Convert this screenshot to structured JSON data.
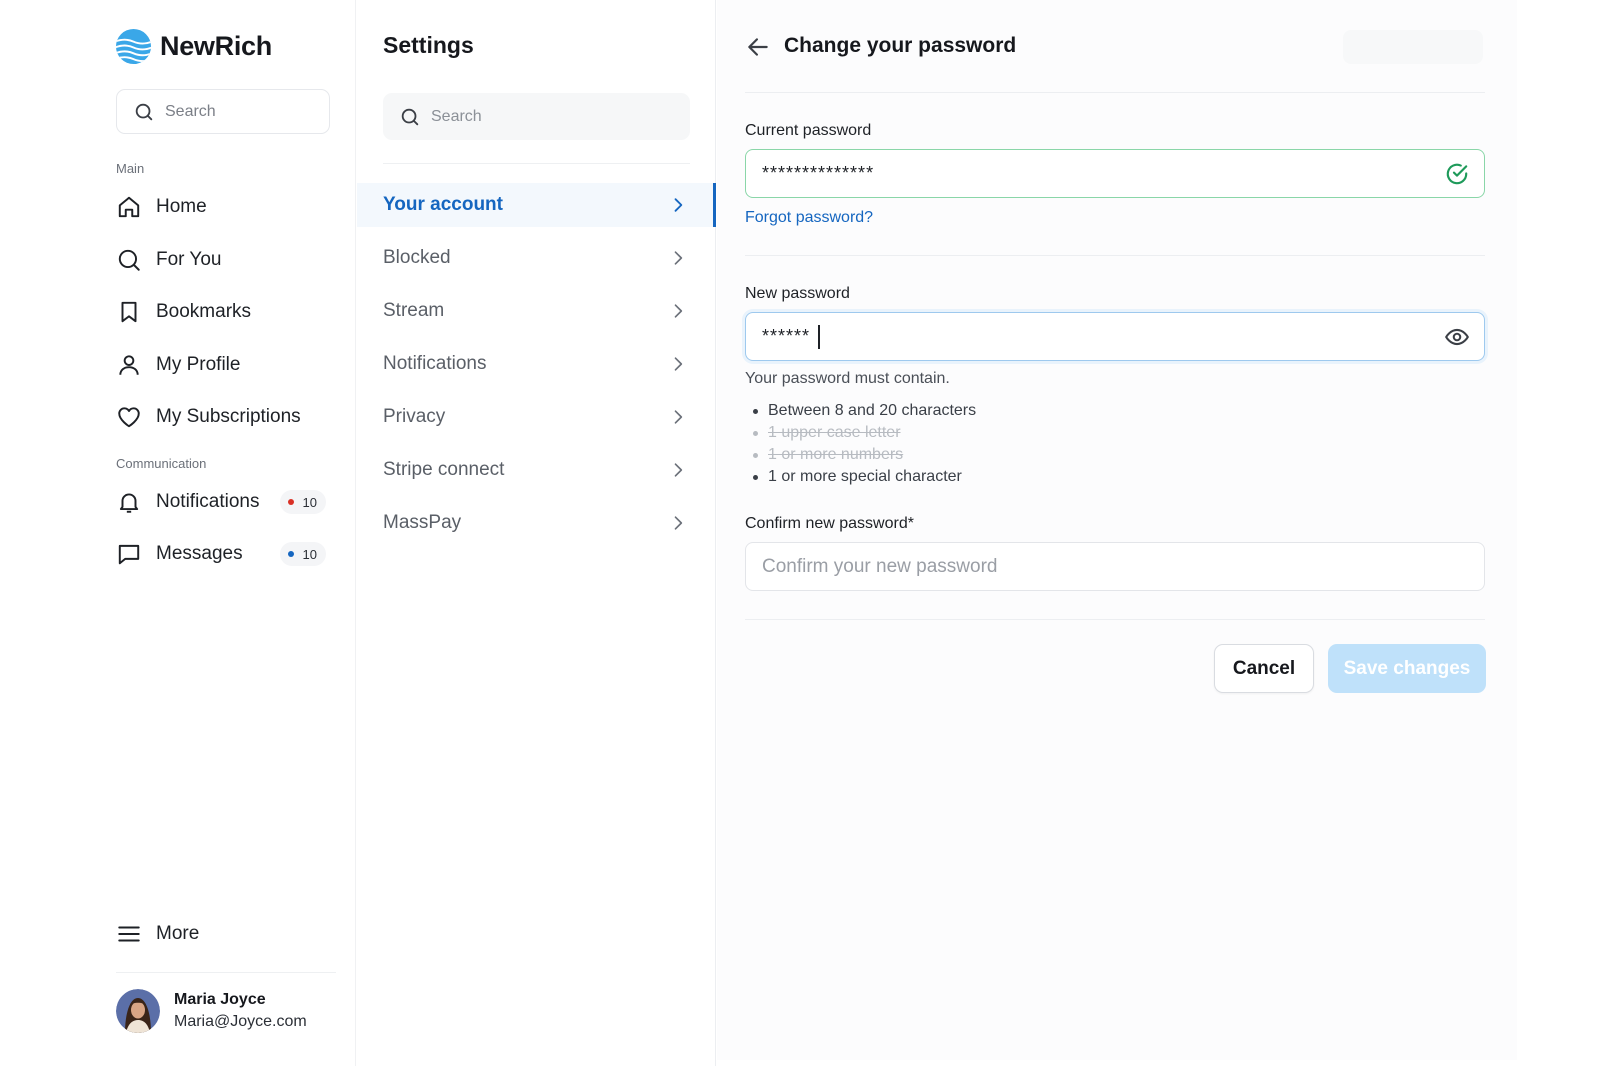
{
  "brand": {
    "name": "NewRich",
    "logo_color": "#3aa7e8"
  },
  "sidebar": {
    "search_placeholder": "Search",
    "section_main": "Main",
    "main_items": [
      {
        "label": "Home",
        "icon": "home-icon"
      },
      {
        "label": "For You",
        "icon": "search-icon"
      },
      {
        "label": "Bookmarks",
        "icon": "bookmark-icon"
      },
      {
        "label": "My Profile",
        "icon": "user-icon"
      },
      {
        "label": "My Subscriptions",
        "icon": "heart-icon"
      }
    ],
    "section_communication": "Communication",
    "comm_items": [
      {
        "label": "Notifications",
        "icon": "bell-icon",
        "badge": "10",
        "badge_dot_color": "#d93025"
      },
      {
        "label": "Messages",
        "icon": "message-icon",
        "badge": "10",
        "badge_dot_color": "#1566c0"
      }
    ],
    "more_label": "More",
    "user": {
      "name": "Maria Joyce",
      "email": "Maria@Joyce.com"
    }
  },
  "settings": {
    "title": "Settings",
    "search_placeholder": "Search",
    "items": [
      {
        "label": "Your account",
        "active": true
      },
      {
        "label": "Blocked"
      },
      {
        "label": "Stream"
      },
      {
        "label": "Notifications"
      },
      {
        "label": "Privacy"
      },
      {
        "label": "Stripe connect"
      },
      {
        "label": "MassPay"
      }
    ]
  },
  "main": {
    "title": "Change your password",
    "current_password": {
      "label": "Current password",
      "value": "**************"
    },
    "forgot_link": "Forgot password?",
    "new_password": {
      "label": "New password",
      "value": "******"
    },
    "requirements_title": "Your password must contain.",
    "requirements": [
      {
        "text": "Between 8 and 20 characters",
        "done": false
      },
      {
        "text": "1 upper case letter",
        "done": true
      },
      {
        "text": "1 or more numbers",
        "done": true
      },
      {
        "text": "1 or more special character",
        "done": false
      }
    ],
    "confirm_password": {
      "label": "Confirm new password*",
      "placeholder": "Confirm your new password",
      "value": ""
    },
    "cancel_label": "Cancel",
    "save_label": "Save changes"
  },
  "colors": {
    "accent": "#1566c0",
    "valid": "#1e9a5a",
    "save_disabled": "#bfe1fa"
  }
}
